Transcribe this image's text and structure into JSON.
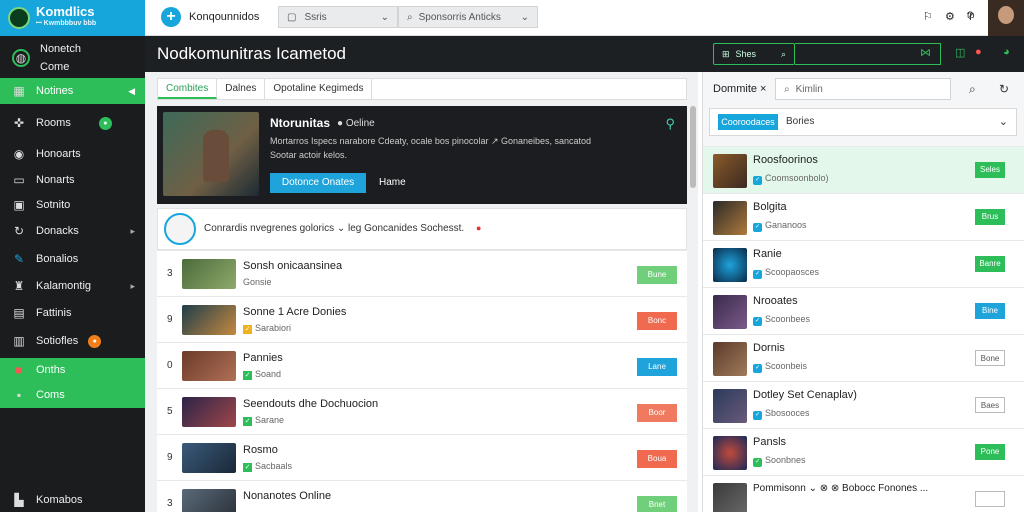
{
  "app": {
    "logo_title": "Komdlics",
    "logo_sub": "ꟷ Kwmbbbuv bbb"
  },
  "sidebar": {
    "header_title": "Nonetch",
    "header_sub": "Come",
    "items": [
      {
        "label": "Notines",
        "icon": "grid-icon",
        "active": true
      },
      {
        "label": "Rooms",
        "icon": "controller-icon",
        "badge": "●",
        "badge_color": "#2dbe5a"
      },
      {
        "label": "Honoarts",
        "icon": "chat-icon"
      },
      {
        "label": "Nonarts",
        "icon": "monitor-icon"
      },
      {
        "label": "Sotnito",
        "icon": "image-icon"
      },
      {
        "label": "Donacks",
        "icon": "refresh-icon",
        "chevron": true
      },
      {
        "label": "Bonalios",
        "icon": "pen-icon"
      },
      {
        "label": "Kalamontig",
        "icon": "trophy-icon",
        "chevron": true
      },
      {
        "label": "Fattinis",
        "icon": "folder-icon"
      },
      {
        "label": "Sotiofles",
        "icon": "book-icon",
        "badge": "●",
        "badge_color": "#f07f1a"
      },
      {
        "label": "Onths",
        "icon": "record-icon",
        "active": true
      },
      {
        "label": "Coms",
        "icon": "check-icon",
        "active": true
      }
    ],
    "footer": "Komabos"
  },
  "topbar": {
    "workspace": "Konqounnidos",
    "select": "Ssris",
    "search": "Sponsorris Anticks",
    "right_icons": [
      "bell-icon",
      "settings-icon",
      "edit-icon",
      "help-icon"
    ],
    "right_labels": [
      "",
      "tp",
      "",
      ""
    ]
  },
  "header": {
    "title": "Nodkomunitras Icametod",
    "search_label": "Shes"
  },
  "tabs": [
    {
      "label": "Combites",
      "active": true
    },
    {
      "label": "Dalnes"
    },
    {
      "label": "Opotaline Kegimeds"
    }
  ],
  "hero": {
    "title": "Ntorunitas",
    "status": "● Oeline",
    "desc": "Mortarros Ispecs narabore Cdeaty, ocale bos pinocolar ↗ Gonaneibes, sancatod Sootar actoir kelos.",
    "primary": "Dotonce Onates",
    "secondary": "Hame"
  },
  "notice": {
    "text": "Conrardis nvegrenes golorics ⌄ leg Goncanides Sochesst.",
    "mark": "●"
  },
  "rows": [
    {
      "num": "3",
      "title": "Sonsh onicaansinea",
      "sub": "Gonsie",
      "btn": "Bune",
      "color": "#6fcf7b",
      "check": false
    },
    {
      "num": "9",
      "title": "Sonne 1 Acre Donies",
      "sub": "Sarabiori",
      "btn": "Bonc",
      "color": "#f06a50",
      "check": true
    },
    {
      "num": "0",
      "title": "Pannies",
      "sub": "Soand",
      "btn": "Lane",
      "color": "#1ea3db",
      "check": true
    },
    {
      "num": "5",
      "title": "Seendouts dhe Dochuocion",
      "sub": "Sarane",
      "btn": "Boor",
      "color": "#f07a60",
      "check": true
    },
    {
      "num": "9",
      "title": "Rosmo",
      "sub": "Sacbaals",
      "btn": "Boua",
      "color": "#f06a50",
      "check": true
    },
    {
      "num": "3",
      "title": "Nonanotes Online",
      "sub": "",
      "btn": "Bnet",
      "color": "#6fcf7b",
      "check": false
    }
  ],
  "rpanel": {
    "title": "Dommite ×",
    "search": "Kimlin",
    "chip": "Cooroodaces",
    "option": "Bories",
    "rows": [
      {
        "title": "Roosfoorinos",
        "sub": "Coomsoonbolo)",
        "btn": "Seles",
        "style": "green",
        "hl": true
      },
      {
        "title": "Bolgita",
        "sub": "Gananoos",
        "btn": "Brus",
        "style": "green"
      },
      {
        "title": "Ranie",
        "sub": "Scoopaosces",
        "btn": "Banre",
        "style": "green"
      },
      {
        "title": "Nrooates",
        "sub": "Scoonbees",
        "btn": "Bine",
        "style": "blue"
      },
      {
        "title": "Dornis",
        "sub": "Scoonbeis",
        "btn": "Bone",
        "style": "outline"
      },
      {
        "title": "Dotley Set Cenaplav)",
        "sub": "Sbosooces",
        "btn": "Baes",
        "style": "outline"
      },
      {
        "title": "Pansls",
        "sub": "Soonbnes",
        "btn": "Pone",
        "style": "green"
      },
      {
        "title": "Pommisonn ⌄ ⊗ ⊗ Bobocc Fonones ...",
        "sub": "",
        "btn": "",
        "style": "outline"
      }
    ]
  },
  "colors": {
    "accent": "#16a6dc",
    "green": "#2dbe5a",
    "dark": "#1a1c1e"
  }
}
